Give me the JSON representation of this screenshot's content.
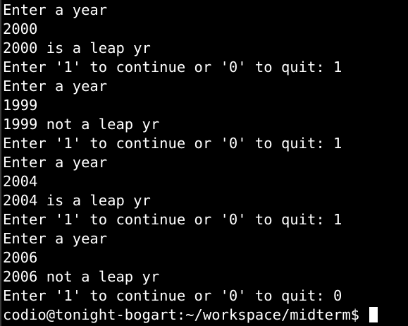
{
  "terminal": {
    "lines": [
      "Enter a year",
      "2000",
      "2000 is a leap yr",
      "Enter '1' to continue or '0' to quit: 1",
      "Enter a year",
      "1999",
      "1999 not a leap yr",
      "Enter '1' to continue or '0' to quit: 1",
      "Enter a year",
      "2004",
      "2004 is a leap yr",
      "Enter '1' to continue or '0' to quit: 1",
      "Enter a year",
      "2006",
      "2006 not a leap yr",
      "Enter '1' to continue or '0' to quit: 0"
    ],
    "prompt": "codio@tonight-bogart:~/workspace/midterm$ ",
    "colors": {
      "background": "#000000",
      "foreground": "#ffffff"
    }
  }
}
